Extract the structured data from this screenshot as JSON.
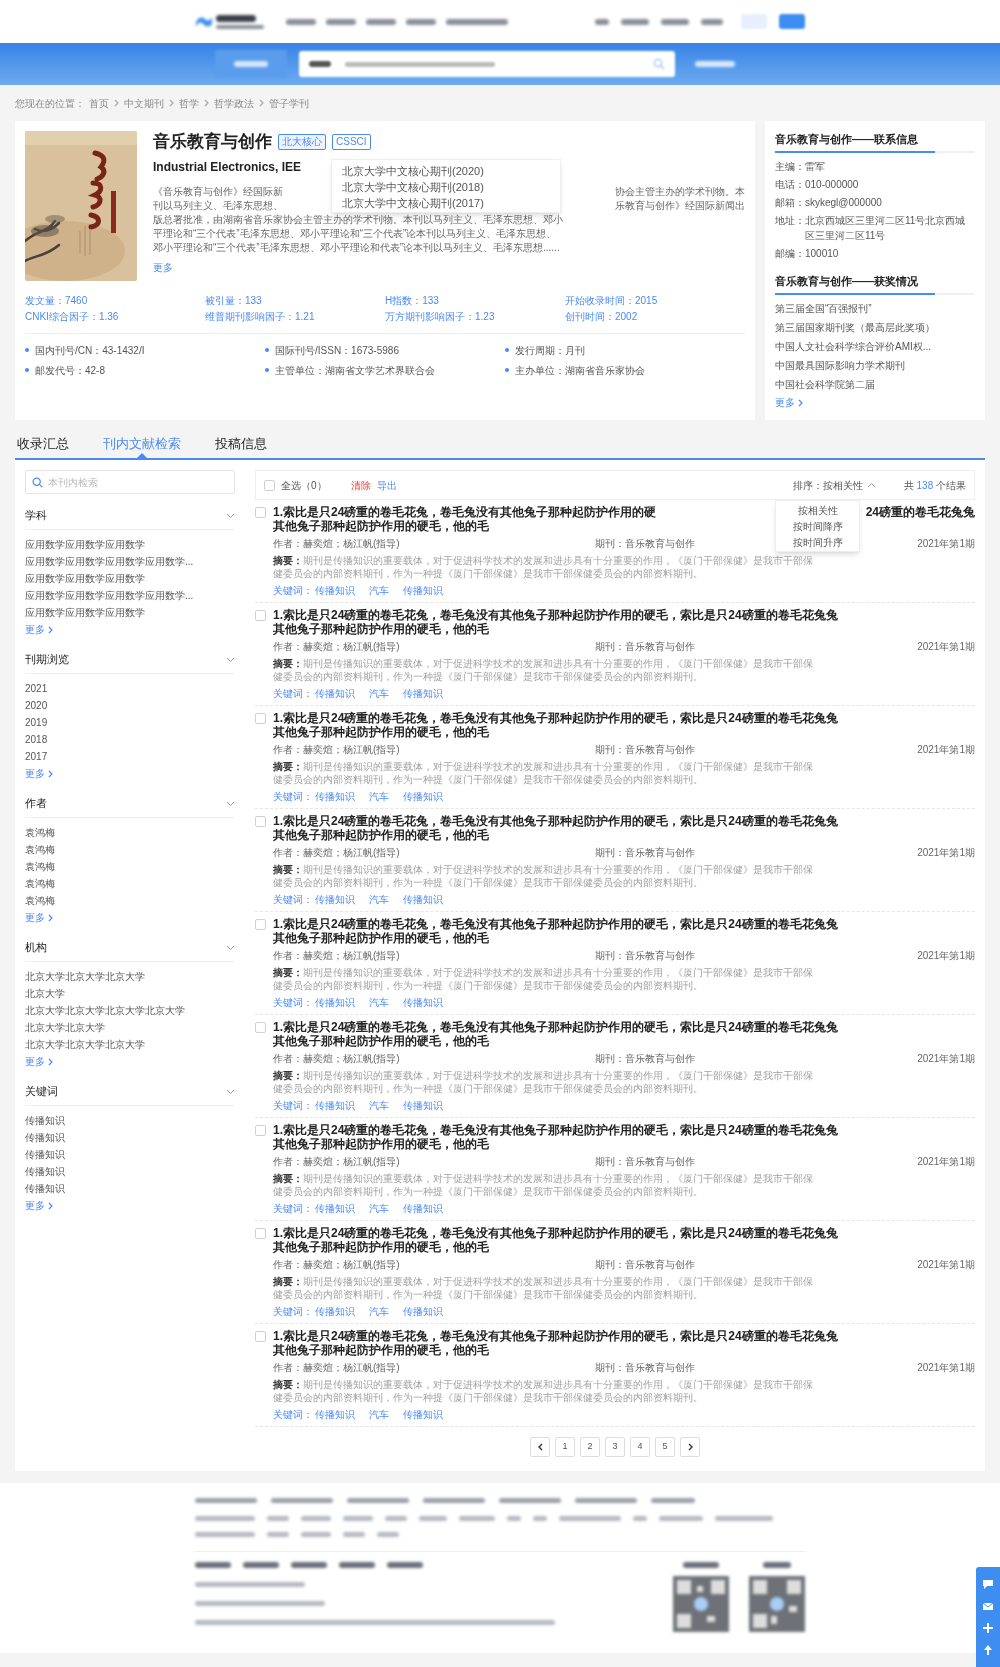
{
  "breadcrumb": {
    "label": "您现在的位置：",
    "items": [
      "首页",
      "中文期刊",
      "哲学",
      "哲学政法",
      "管子学刊"
    ]
  },
  "journal": {
    "title": "音乐教育与创作",
    "tags": [
      "北大核心",
      "CSSCI"
    ],
    "english_title": "Industrial Electronics, IEE",
    "tag_popup": {
      "expanded": true,
      "items": [
        "北京大学中文核心期刊(2020)",
        "北京大学中文核心期刊(2018)",
        "北京大学中文核心期刊(2017)"
      ]
    },
    "description_lines": [
      [
        "《音乐教育与创作》经国际新",
        "协会主管主办的学术刊物。本"
      ],
      [
        "刊以马列主义、毛泽东思想、",
        "乐教育与创作》经国际新闻出"
      ],
      [
        "版总署批准，由湖南省音乐家协会主管主办的学术刊物。本刊以马列主义、毛泽东思想、邓小"
      ],
      [
        "平理论和“三个代表”毛泽东思想、邓小平理论和“三个代表”论本刊以马列主义、毛泽东思想、"
      ],
      [
        "邓小平理论和“三个代表”毛泽东思想、邓小平理论和代表”论本刊以马列主义、毛泽东思想......"
      ]
    ],
    "more": "更多",
    "stats": [
      "发文量：7460",
      "被引量：133",
      "H指数：133",
      "开始收录时间：2015",
      "CNKI综合因子：1.36",
      "维普期刊影响因子：1.21",
      "万方期刊影响因子：1.23",
      "创刊时间：2002"
    ],
    "info": [
      "国内刊号/CN：43-1432/I",
      "国际刊号/ISSN：1673-5986",
      "发行周期：月刊",
      "邮发代号：42-8",
      "主管单位：湖南省文学艺术界联合会",
      "主办单位：湖南省音乐家协会"
    ]
  },
  "contact": {
    "title": "音乐教育与创作——联系信息",
    "fields": [
      {
        "label": "主编：",
        "value": "雷军"
      },
      {
        "label": "电话：",
        "value": "010-000000"
      },
      {
        "label": "邮箱：",
        "value": "skykegl@000000"
      },
      {
        "label": "地址：",
        "value": "北京西城区三里河二区11号北京西城区三里河二区11号"
      },
      {
        "label": "邮编：",
        "value": "100010"
      }
    ]
  },
  "awards": {
    "title": "音乐教育与创作——获奖情况",
    "items": [
      "第三届全国“百强报刊”",
      "第三届国家期刊奖（最高层此奖项）",
      "中国人文社会科学综合评价AMI权...",
      "中国最具国际影响力学术期刊",
      "中国社会科学院第二届"
    ],
    "more": "更多"
  },
  "tabs": [
    {
      "label": "收录汇总",
      "selected": false
    },
    {
      "label": "刊内文献检索",
      "selected": true
    },
    {
      "label": "投稿信息",
      "selected": false
    }
  ],
  "sidebar": {
    "search": {
      "placeholder": "本刊内检索"
    },
    "filters": [
      {
        "title": "学科",
        "items": [
          "应用数学应用数学应用数学",
          "应用数学应用数学应用数学应用数学...",
          "应用数学应用数学应用数学",
          "应用数学应用数学应用数学应用数学...",
          "应用数学应用数学应用数学"
        ],
        "more": "更多"
      },
      {
        "title": "刊期浏览",
        "items": [
          "2021",
          "2020",
          "2019",
          "2018",
          "2017"
        ],
        "more": "更多"
      },
      {
        "title": "作者",
        "items": [
          "袁鸿梅",
          "袁鸿梅",
          "袁鸿梅",
          "袁鸿梅",
          "袁鸿梅"
        ],
        "more": "更多"
      },
      {
        "title": "机构",
        "items": [
          "北京大学北京大学北京大学",
          "北京大学",
          "北京大学北京大学北京大学北京大学",
          "北京大学北京大学",
          "北京大学北京大学北京大学"
        ],
        "more": "更多"
      },
      {
        "title": "关键词",
        "items": [
          "传播知识",
          "传播知识",
          "传播知识",
          "传播知识",
          "传播知识"
        ],
        "more": "更多"
      }
    ]
  },
  "toolbar": {
    "select_all": {
      "label": "全选（0）",
      "checked": false
    },
    "clear": "清除",
    "export": "导出",
    "sort": {
      "label": "排序：按相关性",
      "expanded": true,
      "options": [
        "按相关性",
        "按时间降序",
        "按时间升序"
      ]
    },
    "count_prefix": "共",
    "count": "138",
    "count_suffix": "个结果"
  },
  "results": [
    {
      "checked": false,
      "title_lines": [
        [
          "1.索比是只24磅重的卷毛花兔，卷毛兔没有其他兔子那种起防护作用的硬",
          "24磅重的卷毛花兔兔"
        ],
        [
          "其他兔子那种起防护作用的硬毛，他的毛"
        ]
      ],
      "author": "作者：赫奕煊；杨江帆(指导)",
      "journal": "期刊：音乐教育与创作",
      "issue": "2021年第1期",
      "abstract_label": "摘要：",
      "abstract_lines": [
        "期刊是传播知识的重要载体，对于促进科学技术的发展和进步具有十分重要的作用，《厦门干部保健》是我市干部保",
        "健委员会的内部资料期刊，作为一种提《厦门干部保健》是我市干部保健委员会的内部资料期刊。"
      ],
      "keywords_label": "关键词：",
      "keywords": [
        "传播知识",
        "汽车",
        "传播知识"
      ]
    },
    {
      "checked": false,
      "title_lines": [
        [
          "1.索比是只24磅重的卷毛花兔，卷毛兔没有其他兔子那种起防护作用的硬毛，索比是只24磅重的卷毛花兔兔"
        ],
        [
          "其他兔子那种起防护作用的硬毛，他的毛"
        ]
      ],
      "author": "作者：赫奕煊；杨江帆(指导)",
      "journal": "期刊：音乐教育与创作",
      "issue": "2021年第1期",
      "abstract_label": "摘要：",
      "abstract_lines": [
        "期刊是传播知识的重要载体，对于促进科学技术的发展和进步具有十分重要的作用，《厦门干部保健》是我市干部保",
        "健委员会的内部资料期刊，作为一种提《厦门干部保健》是我市干部保健委员会的内部资料期刊。"
      ],
      "keywords_label": "关键词：",
      "keywords": [
        "传播知识",
        "汽车",
        "传播知识"
      ]
    },
    {
      "checked": false,
      "title_lines": [
        [
          "1.索比是只24磅重的卷毛花兔，卷毛兔没有其他兔子那种起防护作用的硬毛，索比是只24磅重的卷毛花兔兔"
        ],
        [
          "其他兔子那种起防护作用的硬毛，他的毛"
        ]
      ],
      "author": "作者：赫奕煊；杨江帆(指导)",
      "journal": "期刊：音乐教育与创作",
      "issue": "2021年第1期",
      "abstract_label": "摘要：",
      "abstract_lines": [
        "期刊是传播知识的重要载体，对于促进科学技术的发展和进步具有十分重要的作用，《厦门干部保健》是我市干部保",
        "健委员会的内部资料期刊，作为一种提《厦门干部保健》是我市干部保健委员会的内部资料期刊。"
      ],
      "keywords_label": "关键词：",
      "keywords": [
        "传播知识",
        "汽车",
        "传播知识"
      ]
    },
    {
      "checked": false,
      "title_lines": [
        [
          "1.索比是只24磅重的卷毛花兔，卷毛兔没有其他兔子那种起防护作用的硬毛，索比是只24磅重的卷毛花兔兔"
        ],
        [
          "其他兔子那种起防护作用的硬毛，他的毛"
        ]
      ],
      "author": "作者：赫奕煊；杨江帆(指导)",
      "journal": "期刊：音乐教育与创作",
      "issue": "2021年第1期",
      "abstract_label": "摘要：",
      "abstract_lines": [
        "期刊是传播知识的重要载体，对于促进科学技术的发展和进步具有十分重要的作用，《厦门干部保健》是我市干部保",
        "健委员会的内部资料期刊，作为一种提《厦门干部保健》是我市干部保健委员会的内部资料期刊。"
      ],
      "keywords_label": "关键词：",
      "keywords": [
        "传播知识",
        "汽车",
        "传播知识"
      ]
    },
    {
      "checked": false,
      "title_lines": [
        [
          "1.索比是只24磅重的卷毛花兔，卷毛兔没有其他兔子那种起防护作用的硬毛，索比是只24磅重的卷毛花兔兔"
        ],
        [
          "其他兔子那种起防护作用的硬毛，他的毛"
        ]
      ],
      "author": "作者：赫奕煊；杨江帆(指导)",
      "journal": "期刊：音乐教育与创作",
      "issue": "2021年第1期",
      "abstract_label": "摘要：",
      "abstract_lines": [
        "期刊是传播知识的重要载体，对于促进科学技术的发展和进步具有十分重要的作用，《厦门干部保健》是我市干部保",
        "健委员会的内部资料期刊，作为一种提《厦门干部保健》是我市干部保健委员会的内部资料期刊。"
      ],
      "keywords_label": "关键词：",
      "keywords": [
        "传播知识",
        "汽车",
        "传播知识"
      ]
    },
    {
      "checked": false,
      "title_lines": [
        [
          "1.索比是只24磅重的卷毛花兔，卷毛兔没有其他兔子那种起防护作用的硬毛，索比是只24磅重的卷毛花兔兔"
        ],
        [
          "其他兔子那种起防护作用的硬毛，他的毛"
        ]
      ],
      "author": "作者：赫奕煊；杨江帆(指导)",
      "journal": "期刊：音乐教育与创作",
      "issue": "2021年第1期",
      "abstract_label": "摘要：",
      "abstract_lines": [
        "期刊是传播知识的重要载体，对于促进科学技术的发展和进步具有十分重要的作用，《厦门干部保健》是我市干部保",
        "健委员会的内部资料期刊，作为一种提《厦门干部保健》是我市干部保健委员会的内部资料期刊。"
      ],
      "keywords_label": "关键词：",
      "keywords": [
        "传播知识",
        "汽车",
        "传播知识"
      ]
    },
    {
      "checked": false,
      "title_lines": [
        [
          "1.索比是只24磅重的卷毛花兔，卷毛兔没有其他兔子那种起防护作用的硬毛，索比是只24磅重的卷毛花兔兔"
        ],
        [
          "其他兔子那种起防护作用的硬毛，他的毛"
        ]
      ],
      "author": "作者：赫奕煊；杨江帆(指导)",
      "journal": "期刊：音乐教育与创作",
      "issue": "2021年第1期",
      "abstract_label": "摘要：",
      "abstract_lines": [
        "期刊是传播知识的重要载体，对于促进科学技术的发展和进步具有十分重要的作用，《厦门干部保健》是我市干部保",
        "健委员会的内部资料期刊，作为一种提《厦门干部保健》是我市干部保健委员会的内部资料期刊。"
      ],
      "keywords_label": "关键词：",
      "keywords": [
        "传播知识",
        "汽车",
        "传播知识"
      ]
    },
    {
      "checked": false,
      "title_lines": [
        [
          "1.索比是只24磅重的卷毛花兔，卷毛兔没有其他兔子那种起防护作用的硬毛，索比是只24磅重的卷毛花兔兔"
        ],
        [
          "其他兔子那种起防护作用的硬毛，他的毛"
        ]
      ],
      "author": "作者：赫奕煊；杨江帆(指导)",
      "journal": "期刊：音乐教育与创作",
      "issue": "2021年第1期",
      "abstract_label": "摘要：",
      "abstract_lines": [
        "期刊是传播知识的重要载体，对于促进科学技术的发展和进步具有十分重要的作用，《厦门干部保健》是我市干部保",
        "健委员会的内部资料期刊，作为一种提《厦门干部保健》是我市干部保健委员会的内部资料期刊。"
      ],
      "keywords_label": "关键词：",
      "keywords": [
        "传播知识",
        "汽车",
        "传播知识"
      ]
    },
    {
      "checked": false,
      "title_lines": [
        [
          "1.索比是只24磅重的卷毛花兔，卷毛兔没有其他兔子那种起防护作用的硬毛，索比是只24磅重的卷毛花兔兔"
        ],
        [
          "其他兔子那种起防护作用的硬毛，他的毛"
        ]
      ],
      "author": "作者：赫奕煊；杨江帆(指导)",
      "journal": "期刊：音乐教育与创作",
      "issue": "2021年第1期",
      "abstract_label": "摘要：",
      "abstract_lines": [
        "期刊是传播知识的重要载体，对于促进科学技术的发展和进步具有十分重要的作用，《厦门干部保健》是我市干部保",
        "健委员会的内部资料期刊，作为一种提《厦门干部保健》是我市干部保健委员会的内部资料期刊。"
      ],
      "keywords_label": "关键词：",
      "keywords": [
        "传播知识",
        "汽车",
        "传播知识"
      ]
    }
  ],
  "pagination": {
    "pages": [
      {
        "label": "1",
        "selected": false
      },
      {
        "label": "2",
        "selected": false
      },
      {
        "label": "3",
        "selected": false
      },
      {
        "label": "4",
        "selected": false
      },
      {
        "label": "5",
        "selected": false
      }
    ]
  }
}
